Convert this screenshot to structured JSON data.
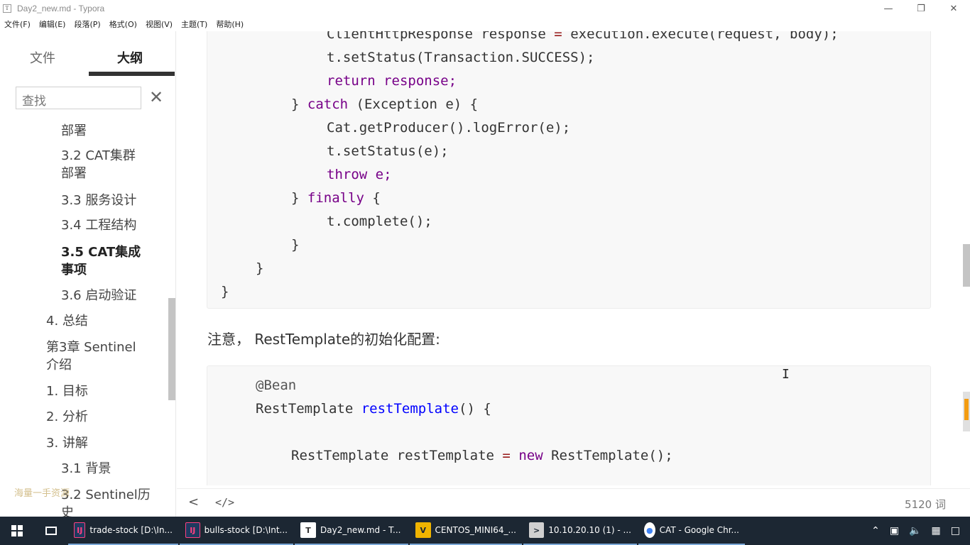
{
  "window": {
    "title": "Day2_new.md - Typora",
    "app_icon": "T",
    "controls": [
      "minimize-icon",
      "restore-icon",
      "close-icon"
    ]
  },
  "menu": [
    "文件(F)",
    "编辑(E)",
    "段落(P)",
    "格式(O)",
    "视图(V)",
    "主题(T)",
    "帮助(H)"
  ],
  "sidebar": {
    "tabs": {
      "files": "文件",
      "outline": "大纲"
    },
    "search_placeholder": "查找",
    "items": [
      {
        "line1": "部署",
        "line2": ""
      },
      {
        "line1": "3.2 CAT集群",
        "line2": "部署"
      },
      {
        "line1": "3.3 服务设计",
        "line2": ""
      },
      {
        "line1": "3.4 工程结构",
        "line2": ""
      },
      {
        "line1": "3.5 CAT集成",
        "line2": "事项"
      },
      {
        "line1": "3.6 启动验证",
        "line2": ""
      },
      {
        "line1": "4. 总结",
        "line2": ""
      },
      {
        "line1": "第3章 Sentinel",
        "line2": "介绍"
      },
      {
        "line1": "1. 目标",
        "line2": ""
      },
      {
        "line1": "2. 分析",
        "line2": ""
      },
      {
        "line1": "3. 讲解",
        "line2": ""
      },
      {
        "line1": "3.1 背景",
        "line2": ""
      },
      {
        "line1": "3.2 Sentinel历",
        "line2": "史"
      }
    ],
    "watermark": "海量一手资源"
  },
  "editor": {
    "code1": [
      "ClientHttpResponse response = execution.execute(request, body);",
      "t.setStatus(Transaction.SUCCESS);",
      "return response;",
      "} catch (Exception e) {",
      "Cat.getProducer().logError(e);",
      "t.setStatus(e);",
      "throw e;",
      "} finally {",
      "t.complete();",
      "}",
      "}",
      "}"
    ],
    "note": "注意， RestTemplate的初始化配置:",
    "code2": [
      "@Bean",
      "RestTemplate restTemplate() {",
      "RestTemplate restTemplate = new RestTemplate();"
    ]
  },
  "status": {
    "back": "<",
    "source_toggle": "</>",
    "word_count": "5120 词"
  },
  "taskbar": {
    "items": [
      {
        "label": "trade-stock [D:\\In...",
        "icon": "intellij-icon"
      },
      {
        "label": "bulls-stock [D:\\Int...",
        "icon": "intellij-icon"
      },
      {
        "label": "Day2_new.md - T...",
        "icon": "typora-icon"
      },
      {
        "label": "CENTOS_MINI64_...",
        "icon": "vm-icon"
      },
      {
        "label": "10.10.20.10 (1) - ...",
        "icon": "terminal-icon"
      },
      {
        "label": "CAT - Google Chr...",
        "icon": "chrome-icon"
      }
    ],
    "colors": {
      "background": "#1c2733",
      "active_underline": "#7aa7d6"
    }
  }
}
